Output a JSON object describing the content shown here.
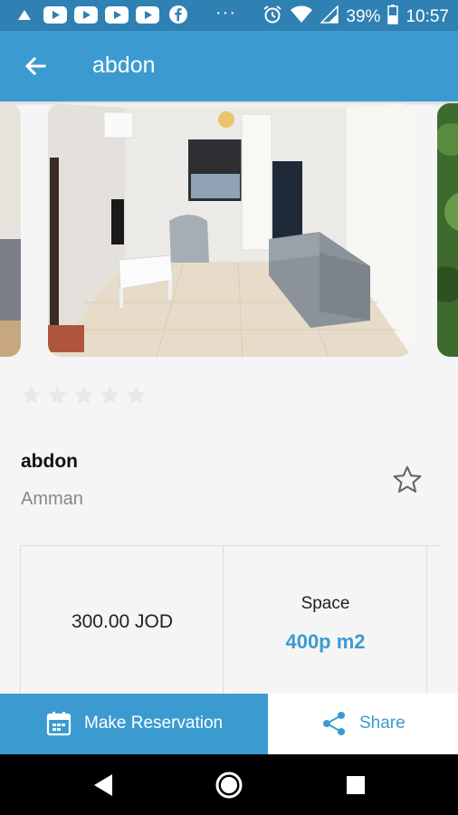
{
  "status_bar": {
    "notification_icons": [
      "app-notification-icon",
      "youtube-icon",
      "youtube-icon",
      "youtube-icon",
      "youtube-icon",
      "facebook-icon"
    ],
    "overflow": "···",
    "battery": "39%",
    "time": "10:57"
  },
  "app_bar": {
    "title": "abdon",
    "back_icon": "arrow-back-icon"
  },
  "carousel": {
    "images": [
      "living-room-photo-previous",
      "living-room-photo",
      "garden-photo-next"
    ]
  },
  "rating": {
    "value": 0,
    "max": 5
  },
  "listing": {
    "name": "abdon",
    "city": "Amman",
    "favorite_icon": "star-outline-icon"
  },
  "details": {
    "price": "300.00 JOD",
    "space_label": "Space",
    "space_value": "400p m2"
  },
  "actions": {
    "reserve_label": "Make Reservation",
    "share_label": "Share"
  },
  "colors": {
    "status_bar": "#2f80b3",
    "primary": "#3b9bd1",
    "background": "#f5f5f5",
    "nav_bar": "#000000"
  }
}
